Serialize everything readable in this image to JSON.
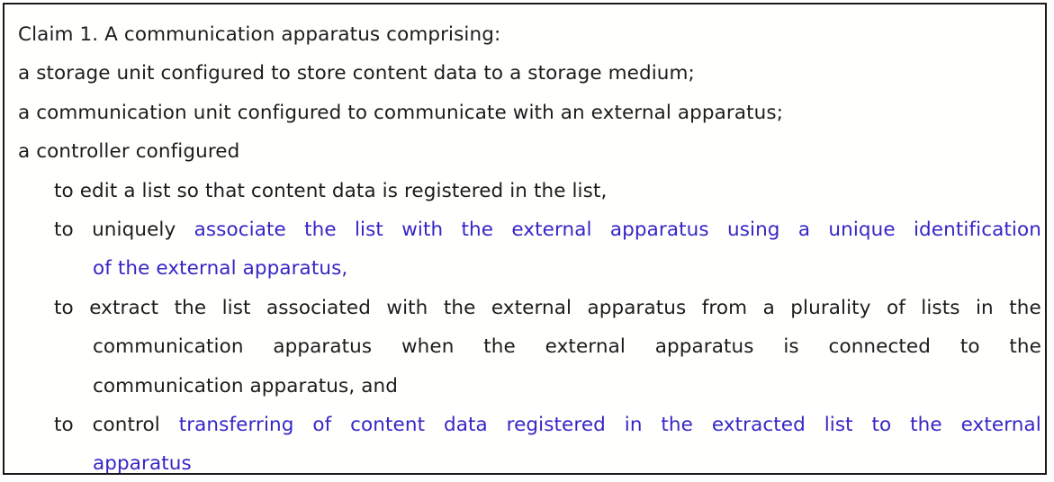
{
  "document": {
    "type": "patent-claim",
    "border_color": "#1a1a1a",
    "background_color": "#fffffd",
    "text_color": "#1c1c1c",
    "highlight_color": "#3526c6"
  },
  "claim": {
    "heading": "Claim 1. A communication apparatus comprising:",
    "preamble_lines": [
      "a storage unit configured to store content data to a storage medium;",
      "a communication unit configured to communicate with an external apparatus;",
      "a controller configured"
    ],
    "clauses": [
      {
        "id": "clause-edit-list",
        "lines": [
          {
            "indent": "lvl1",
            "justified": false,
            "runs": [
              {
                "text": "to edit a list so that content data is registered in the list,",
                "color": "black"
              }
            ]
          }
        ]
      },
      {
        "id": "clause-associate-list",
        "lines": [
          {
            "indent": "lvl1",
            "justified": true,
            "runs": [
              {
                "text": "to",
                "color": "black"
              },
              {
                "text": "uniquely",
                "color": "black"
              },
              {
                "text": "associate",
                "color": "blue"
              },
              {
                "text": "the",
                "color": "blue"
              },
              {
                "text": "list",
                "color": "blue"
              },
              {
                "text": "with",
                "color": "blue"
              },
              {
                "text": "the",
                "color": "blue"
              },
              {
                "text": "external",
                "color": "blue"
              },
              {
                "text": "apparatus",
                "color": "blue"
              },
              {
                "text": "using",
                "color": "blue"
              },
              {
                "text": "a",
                "color": "blue"
              },
              {
                "text": "unique",
                "color": "blue"
              },
              {
                "text": "identification",
                "color": "blue"
              }
            ]
          },
          {
            "indent": "lvl2",
            "justified": false,
            "runs": [
              {
                "text": "of the external apparatus,",
                "color": "blue"
              }
            ]
          }
        ]
      },
      {
        "id": "clause-extract-list",
        "lines": [
          {
            "indent": "lvl1",
            "justified": true,
            "runs": [
              {
                "text": "to",
                "color": "black"
              },
              {
                "text": "extract",
                "color": "black"
              },
              {
                "text": "the",
                "color": "black"
              },
              {
                "text": "list",
                "color": "black"
              },
              {
                "text": "associated",
                "color": "black"
              },
              {
                "text": "with",
                "color": "black"
              },
              {
                "text": "the",
                "color": "black"
              },
              {
                "text": "external",
                "color": "black"
              },
              {
                "text": "apparatus",
                "color": "black"
              },
              {
                "text": "from",
                "color": "black"
              },
              {
                "text": "a",
                "color": "black"
              },
              {
                "text": "plurality",
                "color": "black"
              },
              {
                "text": "of",
                "color": "black"
              },
              {
                "text": "lists",
                "color": "black"
              },
              {
                "text": "in",
                "color": "black"
              },
              {
                "text": "the",
                "color": "black"
              }
            ]
          },
          {
            "indent": "lvl2",
            "justified": true,
            "runs": [
              {
                "text": "communication",
                "color": "black"
              },
              {
                "text": "apparatus",
                "color": "black"
              },
              {
                "text": "when",
                "color": "black"
              },
              {
                "text": "the",
                "color": "black"
              },
              {
                "text": "external",
                "color": "black"
              },
              {
                "text": "apparatus",
                "color": "black"
              },
              {
                "text": "is",
                "color": "black"
              },
              {
                "text": "connected",
                "color": "black"
              },
              {
                "text": "to",
                "color": "black"
              },
              {
                "text": "the",
                "color": "black"
              }
            ]
          },
          {
            "indent": "lvl2",
            "justified": false,
            "runs": [
              {
                "text": "communication apparatus, and",
                "color": "black"
              }
            ]
          }
        ]
      },
      {
        "id": "clause-control-transfer",
        "lines": [
          {
            "indent": "lvl1",
            "justified": true,
            "runs": [
              {
                "text": "to",
                "color": "black"
              },
              {
                "text": "control",
                "color": "black"
              },
              {
                "text": "transferring",
                "color": "blue"
              },
              {
                "text": "of",
                "color": "blue"
              },
              {
                "text": "content",
                "color": "blue"
              },
              {
                "text": "data",
                "color": "blue"
              },
              {
                "text": "registered",
                "color": "blue"
              },
              {
                "text": "in",
                "color": "blue"
              },
              {
                "text": "the",
                "color": "blue"
              },
              {
                "text": "extracted",
                "color": "blue"
              },
              {
                "text": "list",
                "color": "blue"
              },
              {
                "text": "to",
                "color": "blue"
              },
              {
                "text": "the",
                "color": "blue"
              },
              {
                "text": "external",
                "color": "blue"
              }
            ]
          },
          {
            "indent": "lvl2",
            "justified": false,
            "runs": [
              {
                "text": "apparatus",
                "color": "blue"
              }
            ]
          }
        ]
      }
    ]
  }
}
